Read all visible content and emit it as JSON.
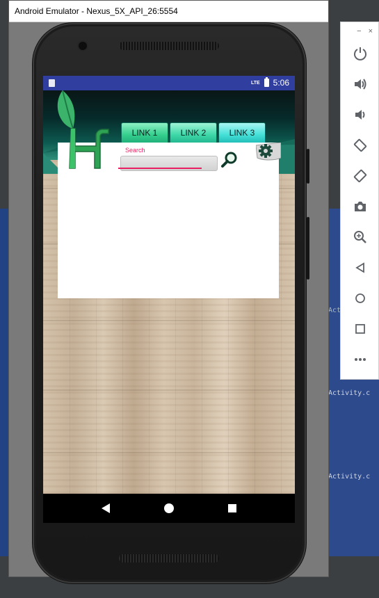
{
  "window": {
    "title": "Android Emulator - Nexus_5X_API_26:5554"
  },
  "statusbar": {
    "network": "LTE",
    "time": "5:06"
  },
  "app": {
    "tabs": [
      {
        "label": "LINK 1"
      },
      {
        "label": "LINK 2"
      },
      {
        "label": "LINK 3"
      }
    ],
    "search": {
      "hint": "Search",
      "value": ""
    },
    "icons": {
      "search": "search-icon",
      "settings": "gear-icon",
      "logo": "logo-icon"
    }
  },
  "navbar": {
    "icons": [
      "back-icon",
      "home-icon",
      "recents-icon"
    ]
  },
  "toolbar": {
    "window_controls": [
      "−",
      "×"
    ],
    "buttons": [
      "power-icon",
      "volume-up-icon",
      "volume-down-icon",
      "rotate-left-icon",
      "rotate-right-icon",
      "camera-icon",
      "zoom-icon",
      "back-icon",
      "home-icon",
      "overview-icon",
      "more-icon"
    ]
  },
  "ide_fragments": {
    "right1": "Activity.c",
    "right2": "Activity.c",
    "right3": "Activity.c"
  },
  "colors": {
    "statusbar": "#303f9f",
    "accent": "#e91e63",
    "tab_green": "#35cf8e"
  }
}
